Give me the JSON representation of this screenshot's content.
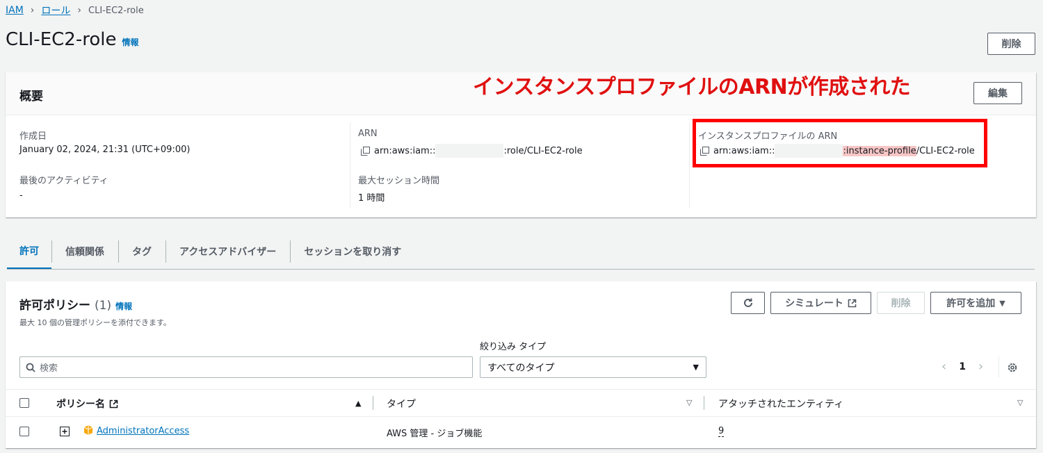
{
  "breadcrumb": {
    "iam": "IAM",
    "roles": "ロール",
    "current": "CLI-EC2-role"
  },
  "page": {
    "title": "CLI-EC2-role",
    "info": "情報",
    "delete_button": "削除"
  },
  "annotation": {
    "text": "インスタンスプロファイルのARNが作成された",
    "color": "#ff0000"
  },
  "summary": {
    "title": "概要",
    "edit_button": "編集",
    "created_label": "作成日",
    "created_value": "January 02, 2024, 21:31 (UTC+09:00)",
    "last_activity_label": "最後のアクティビティ",
    "last_activity_value": "-",
    "arn_label": "ARN",
    "arn_prefix": "arn:aws:iam::",
    "arn_suffix": ":role/CLI-EC2-role",
    "max_session_label": "最大セッション時間",
    "max_session_value": "1 時間",
    "profile_arn_label": "インスタンスプロファイルの ARN",
    "profile_arn_prefix": "arn:aws:iam::",
    "profile_arn_highlight": ":instance-profile",
    "profile_arn_suffix": "/CLI-EC2-role"
  },
  "tabs": [
    {
      "label": "許可",
      "active": true
    },
    {
      "label": "信頼関係"
    },
    {
      "label": "タグ"
    },
    {
      "label": "アクセスアドバイザー"
    },
    {
      "label": "セッションを取り消す"
    }
  ],
  "policies": {
    "title": "許可ポリシー",
    "count": "(1)",
    "info": "情報",
    "description": "最大 10 個の管理ポリシーを添付できます。",
    "simulate_button": "シミュレート",
    "delete_button": "削除",
    "add_button": "許可を追加",
    "filter_type_label": "絞り込み タイプ",
    "search_placeholder": "検索",
    "type_select_value": "すべてのタイプ",
    "page_number": "1",
    "columns": {
      "policy_name": "ポリシー名",
      "type": "タイプ",
      "attached": "アタッチされたエンティティ"
    },
    "rows": [
      {
        "name": "AdministratorAccess",
        "type": "AWS 管理 - ジョブ機能",
        "attached": "9"
      }
    ]
  },
  "colors": {
    "link": "#0073bb",
    "annotation": "#ff0000",
    "highlight": "#f7c6c6"
  }
}
